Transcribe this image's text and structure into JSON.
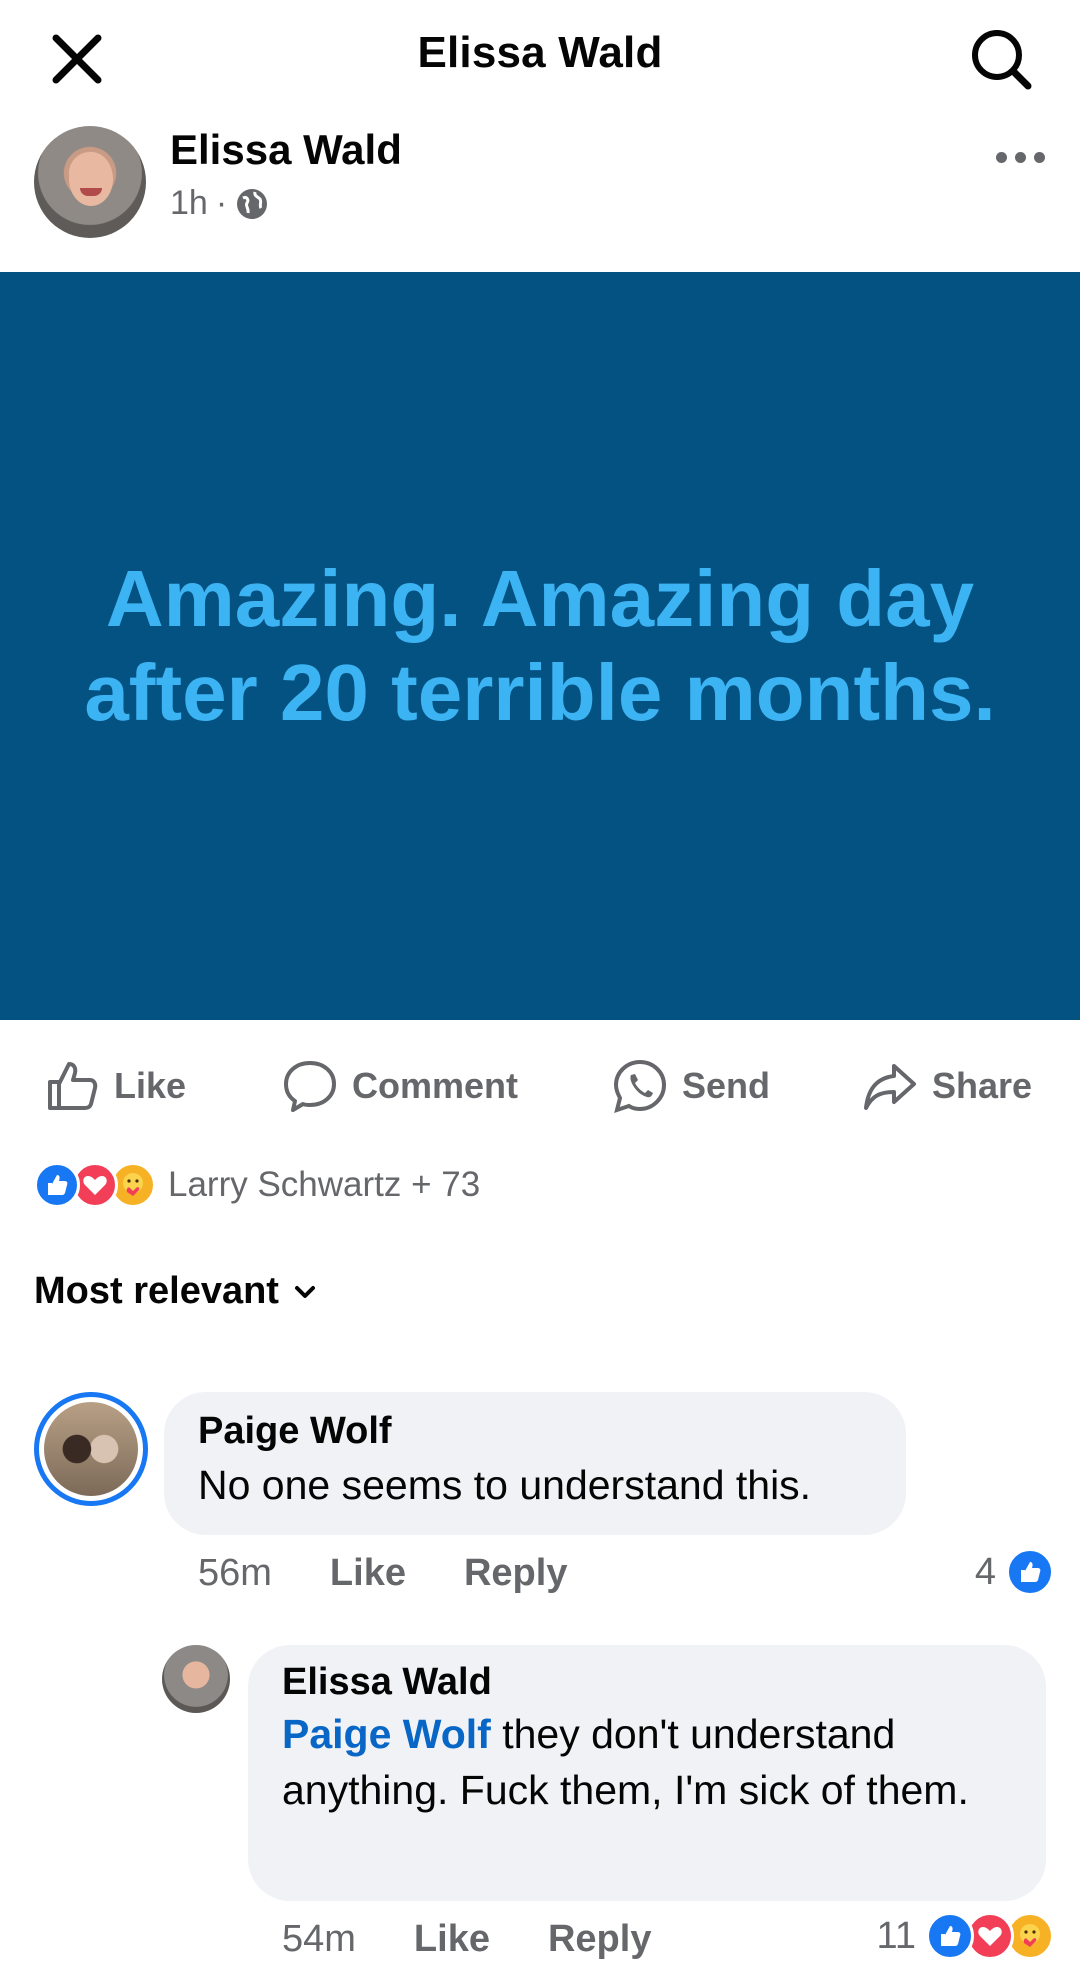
{
  "topbar": {
    "title": "Elissa Wald"
  },
  "post": {
    "author": "Elissa Wald",
    "time": "1h",
    "separator": "·",
    "image_text": "Amazing. Amazing day after 20 terrible months.",
    "image_bg": "#045281",
    "image_text_color": "#3cb3f3"
  },
  "actions": {
    "like": "Like",
    "comment": "Comment",
    "send": "Send",
    "share": "Share"
  },
  "reactions": {
    "names": "Larry Schwartz + 73",
    "icons": [
      "like-icon",
      "love-icon",
      "care-icon"
    ]
  },
  "sort": {
    "label": "Most relevant"
  },
  "comments": [
    {
      "author": "Paige Wolf",
      "text": "No one seems to understand this.",
      "time": "56m",
      "like": "Like",
      "reply": "Reply",
      "reaction_count": "4"
    },
    {
      "author": "Elissa Wald",
      "mention": "Paige Wolf",
      "text": " they don't understand anything. Fuck them, I'm sick of them.",
      "time": "54m",
      "like": "Like",
      "reply": "Reply",
      "reaction_count": "11"
    }
  ],
  "colors": {
    "accent": "#1877f2",
    "muted": "#65676b",
    "bubble": "#f0f2f5",
    "mention": "#0866c6"
  }
}
